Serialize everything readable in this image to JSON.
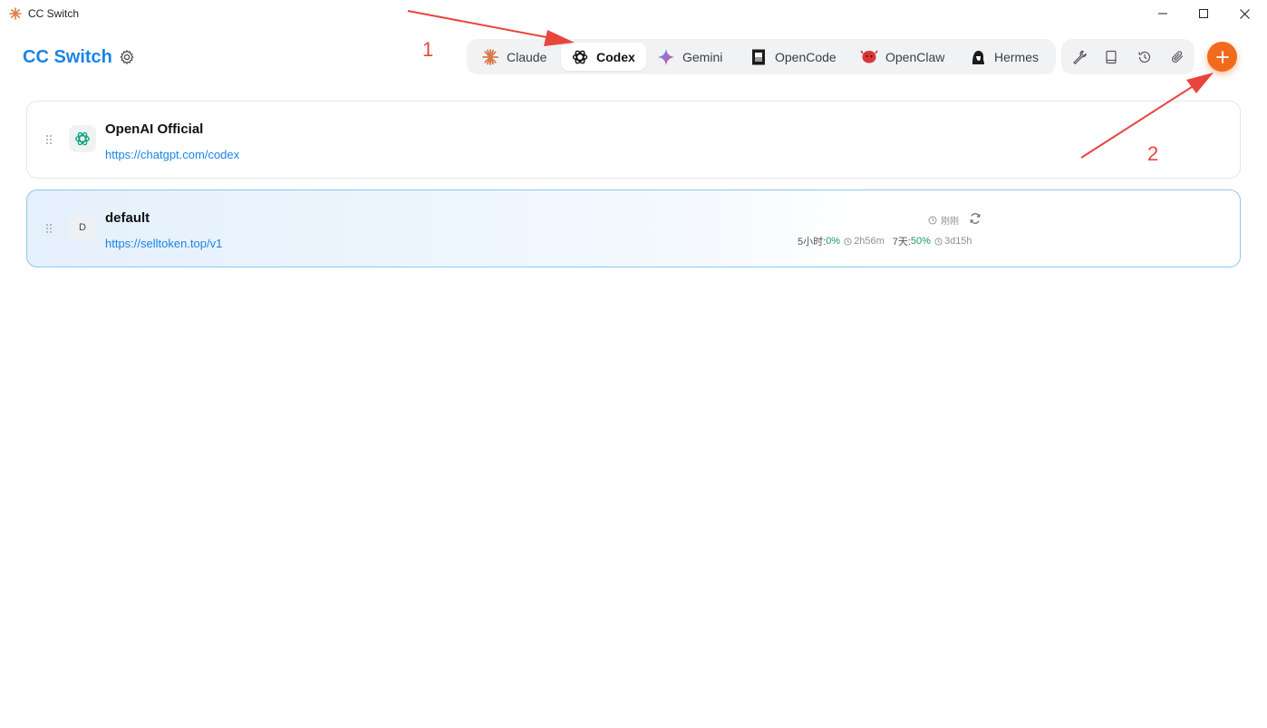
{
  "window": {
    "title": "CC Switch"
  },
  "header": {
    "brand": "CC Switch",
    "tabs": [
      {
        "label": "Claude",
        "icon": "claude-icon",
        "active": false
      },
      {
        "label": "Codex",
        "icon": "codex-icon",
        "active": true
      },
      {
        "label": "Gemini",
        "icon": "gemini-icon",
        "active": false
      },
      {
        "label": "OpenCode",
        "icon": "opencode-icon",
        "active": false
      },
      {
        "label": "OpenClaw",
        "icon": "openclaw-icon",
        "active": false
      },
      {
        "label": "Hermes",
        "icon": "hermes-icon",
        "active": false
      }
    ],
    "tools": [
      "wrench-icon",
      "book-icon",
      "history-icon",
      "paperclip-icon"
    ],
    "add_icon": "plus-icon"
  },
  "providers": [
    {
      "name": "OpenAI Official",
      "url": "https://chatgpt.com/codex",
      "avatar_icon": "openai-icon"
    },
    {
      "name": "default",
      "url": "https://selltoken.top/v1",
      "avatar_letter": "D",
      "selected": true,
      "usage": {
        "updated": "刚刚",
        "five_hour_label": "5小时:",
        "five_hour_pct": "0%",
        "five_hour_reset": "2h56m",
        "seven_day_label": "7天:",
        "seven_day_pct": "50%",
        "seven_day_reset": "3d15h"
      }
    }
  ],
  "annotations": {
    "one": "1",
    "two": "2",
    "color": "#e8453c"
  },
  "colors": {
    "brand": "#1a84e6",
    "accent": "#f26b1d",
    "success": "#1d9b5c"
  }
}
